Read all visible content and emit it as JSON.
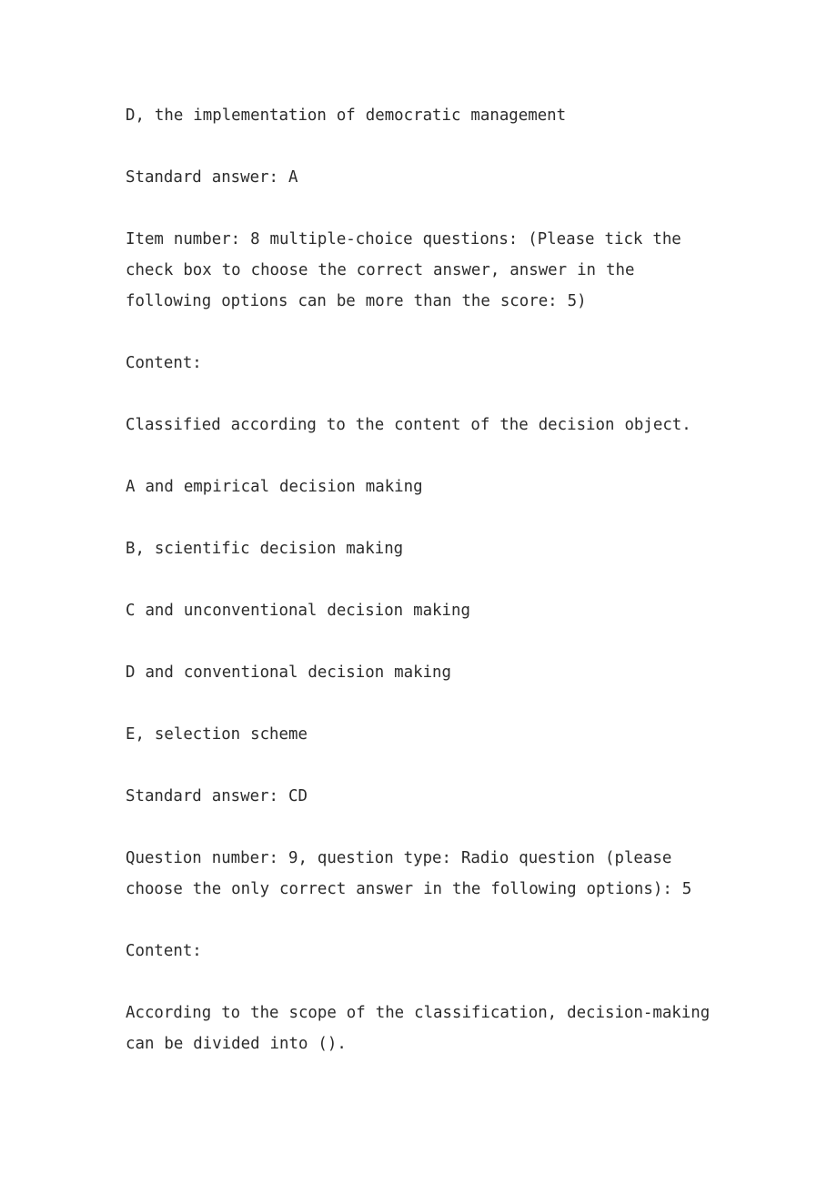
{
  "document": {
    "page_background": "#ffffff",
    "text_color": "#2b2b2b",
    "paragraphs": [
      {
        "id": "option-d-previous-question",
        "text": "D, the implementation of democratic management"
      },
      {
        "id": "standard-answer-a",
        "text": "Standard answer: A"
      },
      {
        "id": "item-number-8-header",
        "text": "Item number: 8 multiple-choice questions: (Please tick the check box to choose the correct answer, answer in the following options can be more than the score: 5)"
      },
      {
        "id": "content-label-q8",
        "text": "Content:"
      },
      {
        "id": "question-8-stem",
        "text": "Classified according to the content of the decision object."
      },
      {
        "id": "q8-option-a",
        "text": "A and empirical decision making"
      },
      {
        "id": "q8-option-b",
        "text": "B, scientific decision making"
      },
      {
        "id": "q8-option-c",
        "text": "C and unconventional decision making"
      },
      {
        "id": "q8-option-d",
        "text": "D and conventional decision making"
      },
      {
        "id": "q8-option-e",
        "text": "E, selection scheme"
      },
      {
        "id": "standard-answer-cd",
        "text": "Standard answer: CD"
      },
      {
        "id": "question-number-9-header",
        "text": "Question number: 9, question type: Radio question (please choose the only correct answer in the following options): 5"
      },
      {
        "id": "content-label-q9",
        "text": "Content:"
      },
      {
        "id": "question-9-stem",
        "text": "According to the scope of the classification, decision-making can be divided into ()."
      }
    ]
  }
}
